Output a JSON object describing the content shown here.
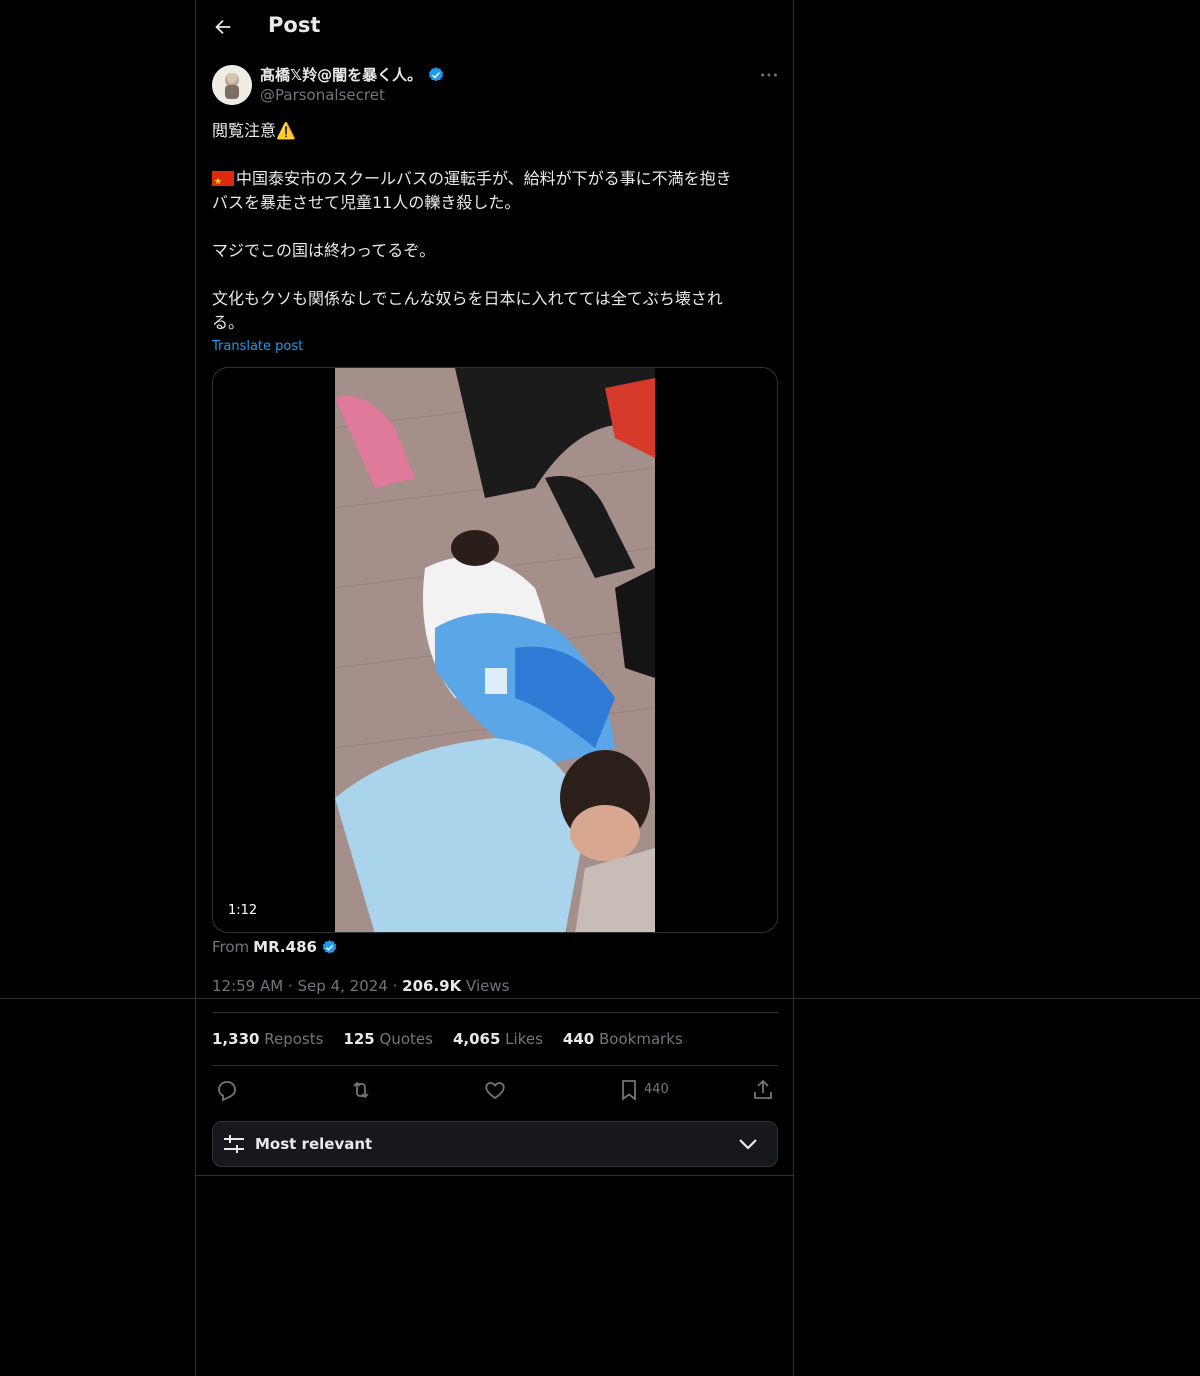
{
  "header": {
    "title": "Post"
  },
  "author": {
    "display_name": "髙橋𝕏羚@闇を暴く人。",
    "handle": "@Parsonalsecret",
    "verified": true
  },
  "post": {
    "paragraph_1": "閲覧注意⚠️",
    "paragraph_2": "中国泰安市のスクールバスの運転手が、給料が下がる事に不満を抱き\nバスを暴走させて児童11人の轢き殺した。",
    "paragraph_3": "マジでこの国は終わってるぞ。",
    "paragraph_4": "文化もクソも関係なしでこんな奴らを日本に入れてては全てぶち壊され\nる。",
    "translate_label": "Translate post"
  },
  "media": {
    "duration": "1:12",
    "from_label": "From",
    "from_account": "MR.486"
  },
  "meta": {
    "time": "12:59 AM",
    "date": "Sep 4, 2024",
    "views_count": "206.9K",
    "views_label": "Views"
  },
  "stats": {
    "reposts_count": "1,330",
    "reposts_label": "Reposts",
    "quotes_count": "125",
    "quotes_label": "Quotes",
    "likes_count": "4,065",
    "likes_label": "Likes",
    "bookmarks_count": "440",
    "bookmarks_label": "Bookmarks"
  },
  "actions": {
    "bookmark_count": "440"
  },
  "sort": {
    "label": "Most relevant"
  },
  "colors": {
    "accent": "#1d9bf0",
    "background": "#000000",
    "border": "#2f3336",
    "muted": "#71767b"
  },
  "icons": [
    "back-arrow-icon",
    "verified-badge-icon",
    "more-icon",
    "reply-icon",
    "repost-icon",
    "like-icon",
    "bookmark-icon",
    "share-icon",
    "sliders-icon",
    "chevron-down-icon"
  ]
}
